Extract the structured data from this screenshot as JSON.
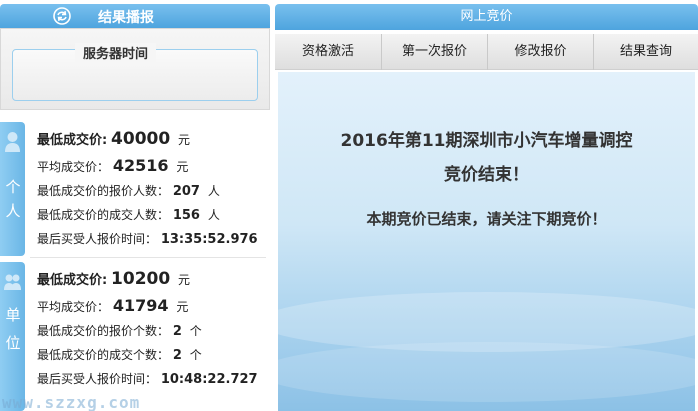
{
  "left_panel": {
    "header_title": "结果播报",
    "server_time_label": "服务器时间",
    "watermark": "www.szzxg.com"
  },
  "personal": {
    "category_chars": [
      "个",
      "人"
    ],
    "min_price_label": "最低成交价:",
    "min_price_value": "40000",
    "min_price_unit": "元",
    "avg_price_label": "平均成交价：",
    "avg_price_value": "42516",
    "avg_price_unit": "元",
    "bidders_label": "最低成交价的报价人数：",
    "bidders_value": "207",
    "bidders_unit": "人",
    "deals_label": "最低成交价的成交人数：",
    "deals_value": "156",
    "deals_unit": "人",
    "last_time_label": "最后买受人报价时间：",
    "last_time_value": "13:35:52.976"
  },
  "unit": {
    "category_chars": [
      "单",
      "位"
    ],
    "min_price_label": "最低成交价:",
    "min_price_value": "10200",
    "min_price_unit": "元",
    "avg_price_label": "平均成交价：",
    "avg_price_value": "41794",
    "avg_price_unit": "元",
    "bidders_label": "最低成交价的报价个数：",
    "bidders_value": "2",
    "bidders_unit": "个",
    "deals_label": "最低成交价的成交个数：",
    "deals_value": "2",
    "deals_unit": "个",
    "last_time_label": "最后买受人报价时间：",
    "last_time_value": "10:48:22.727"
  },
  "right_panel": {
    "header_title": "网上竞价",
    "tabs": [
      "资格激活",
      "第一次报价",
      "修改报价",
      "结果查询"
    ],
    "message_line1": "2016年第11期深圳市小汽车增量调控",
    "message_line2": "竞价结束！",
    "message_sub": "本期竞价已结束，请关注下期竞价！"
  },
  "colors": {
    "header_blue": "#4ea4de",
    "category_blue": "#6ab6e6"
  }
}
